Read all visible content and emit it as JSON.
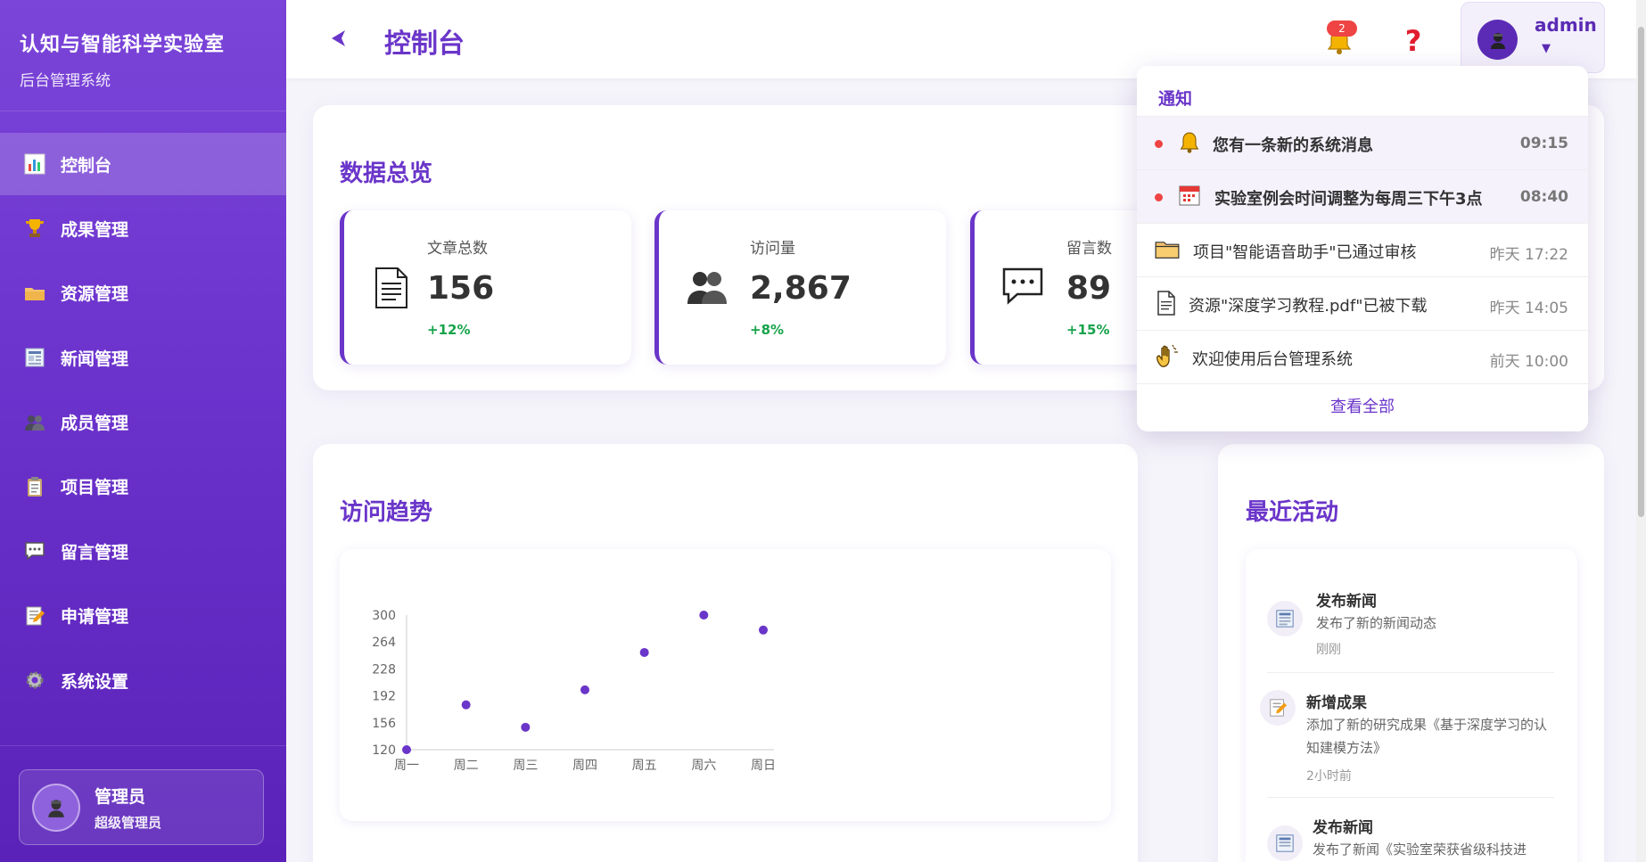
{
  "sidebar": {
    "brand_title": "认知与智能科学实验室",
    "brand_subtitle": "后台管理系统",
    "items": [
      {
        "label": "控制台",
        "icon": "bar-chart-icon",
        "active": true
      },
      {
        "label": "成果管理",
        "icon": "trophy-icon"
      },
      {
        "label": "资源管理",
        "icon": "folder-icon"
      },
      {
        "label": "新闻管理",
        "icon": "newspaper-icon"
      },
      {
        "label": "成员管理",
        "icon": "users-icon"
      },
      {
        "label": "项目管理",
        "icon": "clipboard-icon"
      },
      {
        "label": "留言管理",
        "icon": "chat-icon"
      },
      {
        "label": "申请管理",
        "icon": "memo-icon"
      },
      {
        "label": "系统设置",
        "icon": "gear-icon"
      }
    ],
    "user": {
      "name": "管理员",
      "role": "超级管理员"
    }
  },
  "header": {
    "title": "控制台",
    "notification_count": "2",
    "help_symbol": "?",
    "username": "admin",
    "caret": "▼"
  },
  "overview": {
    "title": "数据总览",
    "stats": [
      {
        "label": "文章总数",
        "value": "156",
        "change": "+12%",
        "icon": "document-icon"
      },
      {
        "label": "访问量",
        "value": "2,867",
        "change": "+8%",
        "icon": "users-icon"
      },
      {
        "label": "留言数",
        "value": "89",
        "change": "+15%",
        "icon": "speech-bubble-icon"
      }
    ]
  },
  "trend": {
    "title": "访问趋势"
  },
  "chart_data": {
    "type": "scatter",
    "categories": [
      "周一",
      "周二",
      "周三",
      "周四",
      "周五",
      "周六",
      "周日"
    ],
    "values": [
      120,
      180,
      150,
      200,
      250,
      300,
      280
    ],
    "yticks": [
      120,
      156,
      192,
      228,
      264,
      300
    ],
    "ylim": [
      120,
      300
    ],
    "color": "#6a35c9",
    "grid": false
  },
  "activity": {
    "title": "最近活动",
    "items": [
      {
        "title": "发布新闻",
        "desc": "发布了新的新闻动态",
        "time": "刚刚",
        "icon": "newspaper-icon"
      },
      {
        "title": "新增成果",
        "desc": "添加了新的研究成果《基于深度学习的认知建模方法》",
        "time": "2小时前",
        "icon": "memo-icon"
      },
      {
        "title": "发布新闻",
        "desc": "发布了新闻《实验室荣获省级科技进",
        "time": "",
        "icon": "newspaper-icon"
      }
    ]
  },
  "notifications": {
    "title": "通知",
    "items": [
      {
        "text": "您有一条新的系统消息",
        "time": "09:15",
        "unread": true,
        "icon": "bell-icon"
      },
      {
        "text": "实验室例会时间调整为每周三下午3点",
        "time": "08:40",
        "unread": true,
        "icon": "calendar-icon"
      },
      {
        "text": "项目\"智能语音助手\"已通过审核",
        "time": "昨天 17:22",
        "unread": false,
        "icon": "folder-icon"
      },
      {
        "text": "资源\"深度学习教程.pdf\"已被下载",
        "time": "昨天 14:05",
        "unread": false,
        "icon": "document-icon"
      },
      {
        "text": "欢迎使用后台管理系统",
        "time": "前天 10:00",
        "unread": false,
        "icon": "waving-hand-icon"
      }
    ],
    "view_all": "查看全部"
  }
}
